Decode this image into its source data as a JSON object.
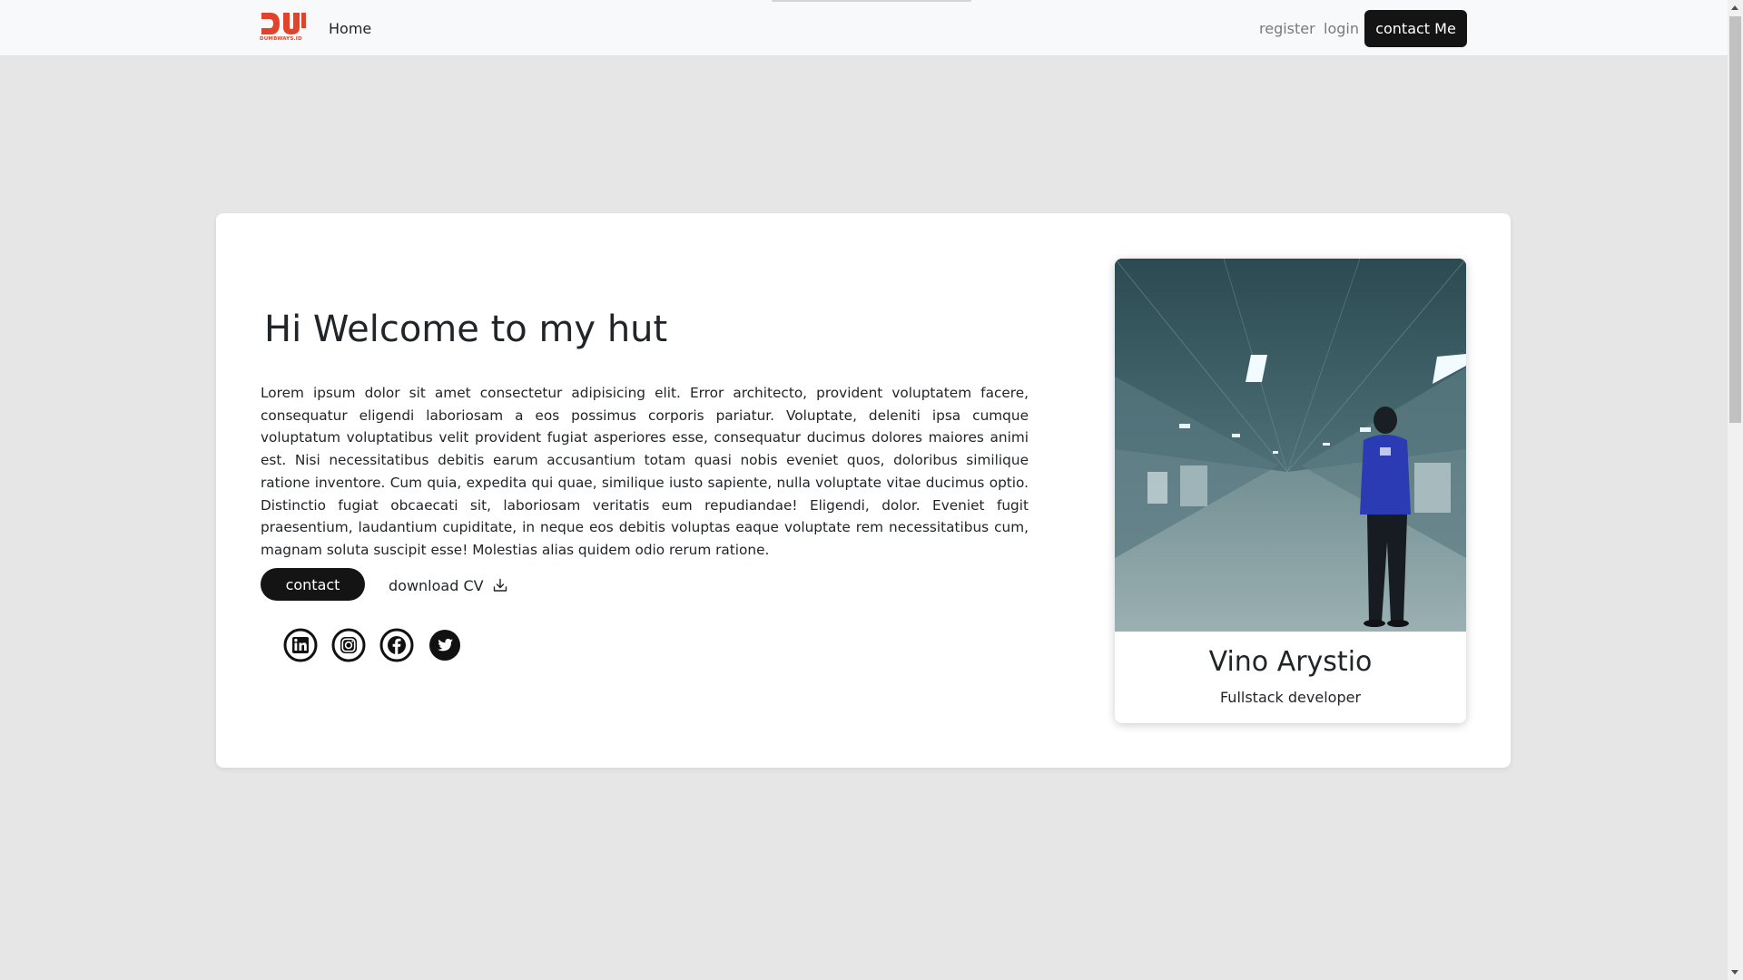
{
  "navbar": {
    "logo_text": "DUMBWAYS.ID",
    "home": "Home",
    "register": "register",
    "login": "login",
    "contact_me": "contact Me"
  },
  "hero": {
    "title": "Hi Welcome to my hut",
    "paragraph": "Lorem ipsum dolor sit amet consectetur adipisicing elit. Error architecto, provident voluptatem facere, consequatur eligendi laboriosam a eos possimus corporis pariatur. Voluptate, deleniti ipsa cumque voluptatum voluptatibus velit provident fugiat asperiores esse, consequatur ducimus dolores maiores animi est. Nisi necessitatibus debitis earum accusantium totam quasi nobis eveniet quos, doloribus similique ratione inventore. Cum quia, expedita qui quae, similique iusto sapiente, nulla voluptate vitae ducimus optio. Distinctio fugiat obcaecati sit, laboriosam veritatis eum repudiandae! Eligendi, dolor. Eveniet fugit praesentium, laudantium cupiditate, in neque eos debitis voluptas eaque voluptate rem necessitatibus cum, magnam soluta suscipit esse! Molestias alias quidem odio rerum ratione.",
    "contact_button": "contact",
    "download_cv": "download CV",
    "socials": [
      "linkedin-icon",
      "instagram-icon",
      "facebook-icon",
      "twitter-icon"
    ]
  },
  "profile": {
    "name": "Vino Arystio",
    "role": "Fullstack developer"
  },
  "colors": {
    "brand_red": "#e0452c",
    "dark_button": "#141414",
    "page_background": "#e6e6e6"
  }
}
